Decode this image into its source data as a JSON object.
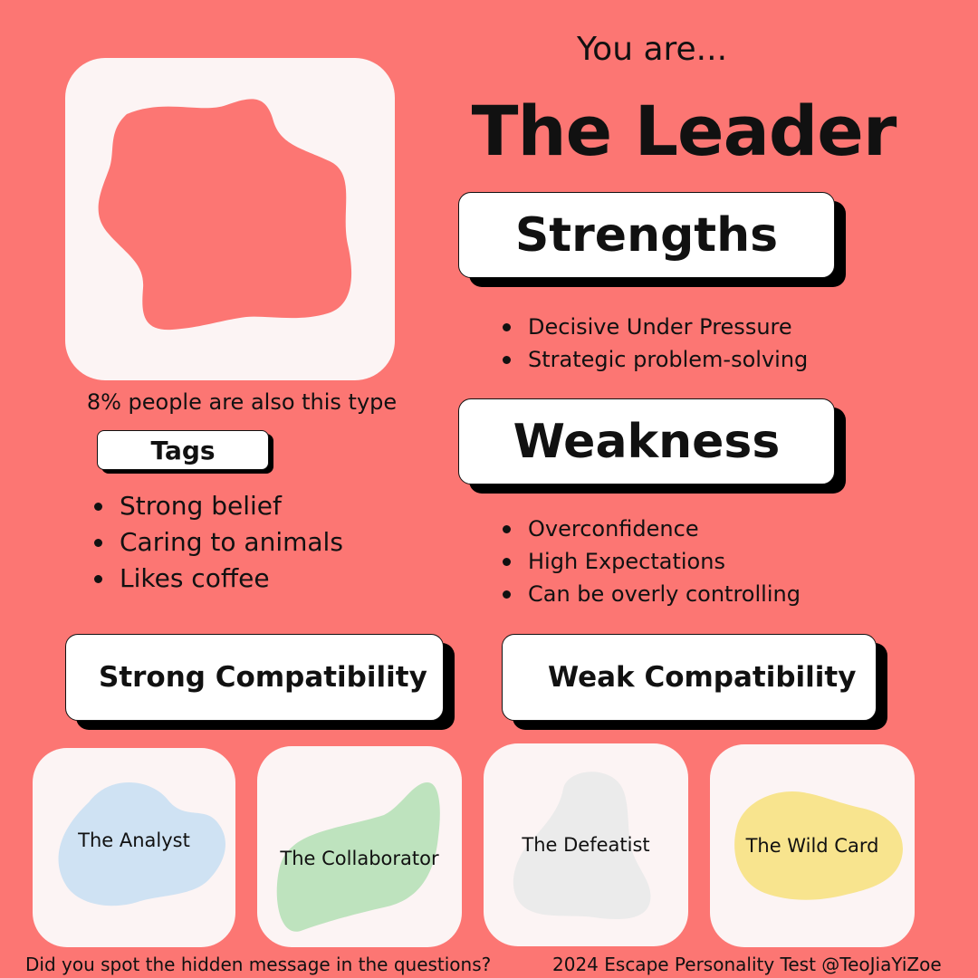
{
  "header": {
    "intro": "You are...",
    "type_name": "The Leader"
  },
  "share_text": "8% people are also this type",
  "share_percent": 8,
  "strengths": {
    "title": "Strengths",
    "items": [
      "Decisive Under Pressure",
      "Strategic problem-solving"
    ]
  },
  "weakness": {
    "title": "Weakness",
    "items": [
      "Overconfidence",
      "High Expectations",
      "Can be overly controlling"
    ]
  },
  "tags": {
    "title": "Tags",
    "items": [
      "Strong belief",
      "Caring to animals",
      "Likes coffee"
    ]
  },
  "compatibility": {
    "strong_title": "Strong Compatibility",
    "weak_title": "Weak Compatibility",
    "strong": [
      {
        "name": "The Analyst",
        "blob_color": "#CFE2F3"
      },
      {
        "name": "The Collaborator",
        "blob_color": "#BEE3BE"
      }
    ],
    "weak": [
      {
        "name": "The Defeatist",
        "blob_color": "#EBEBEB"
      },
      {
        "name": "The Wild Card",
        "blob_color": "#F8E48E"
      }
    ]
  },
  "footer": {
    "left": "Did you spot the hidden message in the questions?",
    "right": "2024 Escape Personality Test @TeoJiaYiZoe"
  },
  "colors": {
    "background": "#FC7673",
    "card": "#FCF4F4",
    "leader_blob": "#FC7673"
  }
}
